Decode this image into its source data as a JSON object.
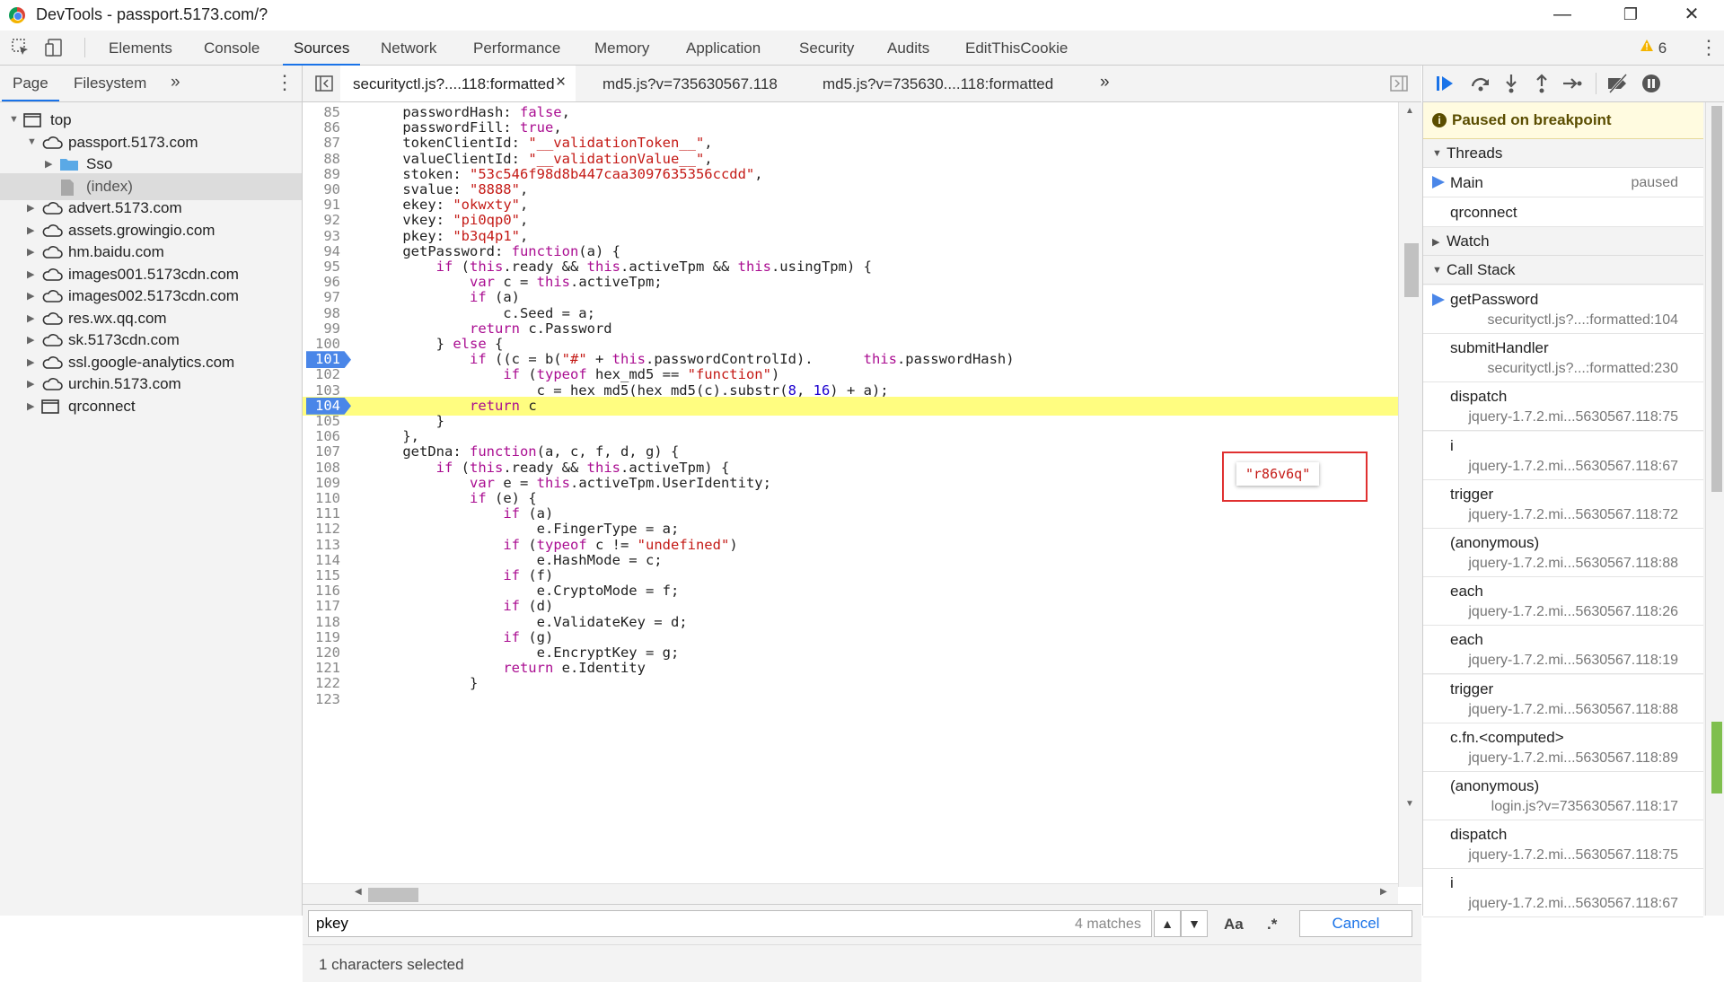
{
  "window": {
    "title": "DevTools - passport.5173.com/?",
    "minimize": "—",
    "restore": "❐",
    "close": "✕"
  },
  "main_tabs": [
    "Elements",
    "Console",
    "Sources",
    "Network",
    "Performance",
    "Memory",
    "Application",
    "Security",
    "Audits",
    "EditThisCookie"
  ],
  "active_main_tab": "Sources",
  "warnings": {
    "icon": "warning-icon",
    "count": "6"
  },
  "navigator": {
    "tabs": [
      "Page",
      "Filesystem"
    ],
    "more": "»",
    "items": [
      {
        "label": "top",
        "icon": "frame"
      },
      {
        "label": "passport.5173.com",
        "icon": "cloud"
      },
      {
        "label": "Sso",
        "icon": "folder"
      },
      {
        "label": "(index)",
        "icon": "file"
      },
      {
        "label": "advert.5173.com",
        "icon": "cloud"
      },
      {
        "label": "assets.growingio.com",
        "icon": "cloud"
      },
      {
        "label": "hm.baidu.com",
        "icon": "cloud"
      },
      {
        "label": "images001.5173cdn.com",
        "icon": "cloud"
      },
      {
        "label": "images002.5173cdn.com",
        "icon": "cloud"
      },
      {
        "label": "res.wx.qq.com",
        "icon": "cloud"
      },
      {
        "label": "sk.5173cdn.com",
        "icon": "cloud"
      },
      {
        "label": "ssl.google-analytics.com",
        "icon": "cloud"
      },
      {
        "label": "urchin.5173.com",
        "icon": "cloud"
      },
      {
        "label": "qrconnect",
        "icon": "frame"
      }
    ]
  },
  "editor": {
    "file_tabs": [
      {
        "label": "securityctl.js?....118:formatted",
        "close": "×"
      },
      {
        "label": "md5.js?v=735630567.118"
      },
      {
        "label": "md5.js?v=735630....118:formatted"
      }
    ],
    "more": "»",
    "lines": [
      {
        "n": "85",
        "t": "    passwordHash: false,"
      },
      {
        "n": "86",
        "t": "    passwordFill: true,"
      },
      {
        "n": "87",
        "t": "    tokenClientId: \"__validationToken__\","
      },
      {
        "n": "88",
        "t": "    valueClientId: \"__validationValue__\","
      },
      {
        "n": "89",
        "t": "    stoken: \"53c546f98d8b447caa3097635356ccdd\","
      },
      {
        "n": "90",
        "t": "    svalue: \"8888\","
      },
      {
        "n": "91",
        "t": "    ekey: \"okwxty\","
      },
      {
        "n": "92",
        "t": "    vkey: \"pi0qp0\","
      },
      {
        "n": "93",
        "t": "    pkey: \"b3q4p1\","
      },
      {
        "n": "94",
        "t": "    getPassword: function(a) {"
      },
      {
        "n": "95",
        "t": "        if (this.ready && this.activeTpm && this.usingTpm) {"
      },
      {
        "n": "96",
        "t": "            var c = this.activeTpm;"
      },
      {
        "n": "97",
        "t": "            if (a)"
      },
      {
        "n": "98",
        "t": "                c.Seed = a;"
      },
      {
        "n": "99",
        "t": "            return c.Password"
      },
      {
        "n": "100",
        "t": "        } else {"
      },
      {
        "n": "101",
        "t": "            if ((c = b(\"#\" + this.passwordControlId).      this.passwordHash)"
      },
      {
        "n": "102",
        "t": "                if (typeof hex_md5 == \"function\")"
      },
      {
        "n": "103",
        "t": "                    c = hex_md5(hex_md5(c).substr(8, 16) + a);"
      },
      {
        "n": "104",
        "t": "            return c"
      },
      {
        "n": "105",
        "t": "        }"
      },
      {
        "n": "106",
        "t": "    },"
      },
      {
        "n": "107",
        "t": "    getDna: function(a, c, f, d, g) {"
      },
      {
        "n": "108",
        "t": "        if (this.ready && this.activeTpm) {"
      },
      {
        "n": "109",
        "t": "            var e = this.activeTpm.UserIdentity;"
      },
      {
        "n": "110",
        "t": "            if (e) {"
      },
      {
        "n": "111",
        "t": "                if (a)"
      },
      {
        "n": "112",
        "t": "                    e.FingerType = a;"
      },
      {
        "n": "113",
        "t": "                if (typeof c != \"undefined\")"
      },
      {
        "n": "114",
        "t": "                    e.HashMode = c;"
      },
      {
        "n": "115",
        "t": "                if (f)"
      },
      {
        "n": "116",
        "t": "                    e.CryptoMode = f;"
      },
      {
        "n": "117",
        "t": "                if (d)"
      },
      {
        "n": "118",
        "t": "                    e.ValidateKey = d;"
      },
      {
        "n": "119",
        "t": "                if (g)"
      },
      {
        "n": "120",
        "t": "                    e.EncryptKey = g;"
      },
      {
        "n": "121",
        "t": "                return e.Identity"
      },
      {
        "n": "122",
        "t": "            }"
      },
      {
        "n": "123",
        "t": ""
      }
    ],
    "breakpoint_line": "101",
    "execution_line": "104",
    "tooltip_value": "\"r86v6q\""
  },
  "search": {
    "query": "pkey",
    "matches": "4 matches",
    "prev": "▲",
    "next": "▼",
    "case_toggle": "Aa",
    "regex_toggle": ".*",
    "cancel": "Cancel"
  },
  "status": "1 characters selected",
  "debugger": {
    "paused_message": "Paused on breakpoint",
    "threads_title": "Threads",
    "threads": [
      {
        "name": "Main",
        "state": "paused",
        "current": true
      },
      {
        "name": "qrconnect",
        "state": ""
      }
    ],
    "watch_title": "Watch",
    "callstack_title": "Call Stack",
    "frames": [
      {
        "fn": "getPassword",
        "loc": "securityctl.js?...:formatted:104",
        "current": true
      },
      {
        "fn": "submitHandler",
        "loc": "securityctl.js?...:formatted:230"
      },
      {
        "fn": "dispatch",
        "loc": "jquery-1.7.2.mi...5630567.118:75"
      },
      {
        "fn": "i",
        "loc": "jquery-1.7.2.mi...5630567.118:67"
      },
      {
        "fn": "trigger",
        "loc": "jquery-1.7.2.mi...5630567.118:72"
      },
      {
        "fn": "(anonymous)",
        "loc": "jquery-1.7.2.mi...5630567.118:88"
      },
      {
        "fn": "each",
        "loc": "jquery-1.7.2.mi...5630567.118:26"
      },
      {
        "fn": "each",
        "loc": "jquery-1.7.2.mi...5630567.118:19"
      },
      {
        "fn": "trigger",
        "loc": "jquery-1.7.2.mi...5630567.118:88"
      },
      {
        "fn": "c.fn.<computed>",
        "loc": "jquery-1.7.2.mi...5630567.118:89"
      },
      {
        "fn": "(anonymous)",
        "loc": "login.js?v=735630567.118:17"
      },
      {
        "fn": "dispatch",
        "loc": "jquery-1.7.2.mi...5630567.118:75"
      },
      {
        "fn": "i",
        "loc": "jquery-1.7.2.mi...5630567.118:67"
      }
    ]
  },
  "colors": {
    "accent": "#1a73e8",
    "breakpoint": "#4a86e8",
    "exec_line": "#fffd80",
    "paused_bg": "#fffbe0",
    "tooltip_border": "#e03030"
  }
}
